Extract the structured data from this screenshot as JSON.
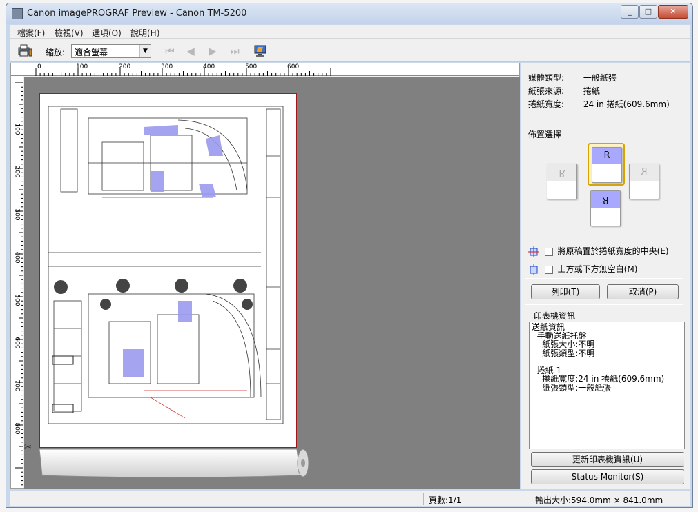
{
  "window": {
    "title": "Canon imagePROGRAF Preview - Canon TM-5200"
  },
  "menu": [
    "檔案(F)",
    "檢視(V)",
    "選項(O)",
    "說明(H)"
  ],
  "toolbar": {
    "zoom_label": "縮放:",
    "zoom_value": "適合螢幕"
  },
  "ruler": {
    "top_ticks": [
      "0",
      "100",
      "200",
      "300",
      "400",
      "500",
      "600"
    ],
    "left_ticks": [
      "100",
      "200",
      "300",
      "400",
      "500",
      "600",
      "700",
      "800"
    ]
  },
  "media": {
    "rows": [
      {
        "label": "媒體類型:",
        "value": "一般紙張"
      },
      {
        "label": "紙張來源:",
        "value": "捲紙"
      },
      {
        "label": "捲紙寬度:",
        "value": "24 in 捲紙(609.6mm)"
      }
    ]
  },
  "layout": {
    "label": "佈置選擇",
    "options": [
      {
        "glyph": "R",
        "state": "inactive-left"
      },
      {
        "glyph": "R",
        "state": "selected"
      },
      {
        "glyph": "R",
        "state": "inactive-right"
      },
      {
        "glyph": "R",
        "state": "rotated"
      }
    ]
  },
  "options": {
    "center": "將原稿置於捲紙寬度的中央(E)",
    "no_margin": "上方或下方無空白(M)"
  },
  "buttons": {
    "print": "列印(T)",
    "cancel": "取消(P)",
    "update": "更新印表機資訊(U)",
    "status": "Status Monitor(S)"
  },
  "printer_info": {
    "label": "印表機資訊",
    "lines": [
      "送紙資訊",
      "  手動送紙托盤",
      "    紙張大小:不明",
      "    紙張類型:不明",
      "",
      "  捲紙 1",
      "    捲紙寬度:24 in 捲紙(609.6mm)",
      "    紙張類型:一般紙張"
    ]
  },
  "status": {
    "pages": "頁數:1/1",
    "output_size": "輸出大小:594.0mm × 841.0mm"
  }
}
